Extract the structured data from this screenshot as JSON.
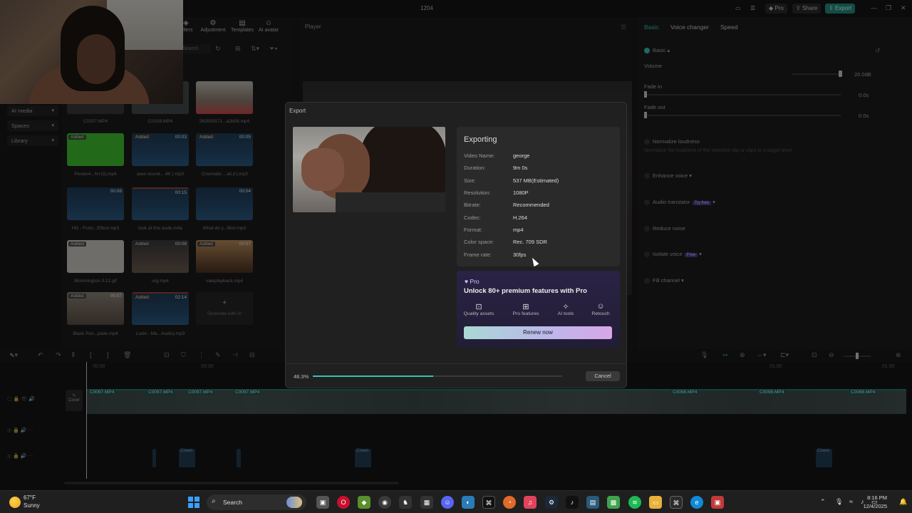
{
  "window": {
    "title": "1204",
    "pro_label": "Pro",
    "share_label": "Share",
    "export_label": "Export",
    "min": "—",
    "max": "❐",
    "close": "✕"
  },
  "toolbar_tabs": [
    {
      "label": "Filters",
      "icon": "filters-icon"
    },
    {
      "label": "Adjustment",
      "icon": "adjustment-icon"
    },
    {
      "label": "Templates",
      "icon": "templates-icon"
    },
    {
      "label": "AI avatar",
      "icon": "ai-avatar-icon"
    }
  ],
  "left_nav": [
    {
      "label": "AI media"
    },
    {
      "label": "Spaces"
    },
    {
      "label": "Library"
    }
  ],
  "media_search_placeholder": "Search",
  "media": [
    {
      "label": "C0207.MP4",
      "badge": "",
      "dur": ""
    },
    {
      "label": "C0108.MP4",
      "badge": "",
      "dur": ""
    },
    {
      "label": "263555571...a2b08.mp4",
      "badge": "",
      "dur": ""
    },
    {
      "label": "Pexels4...N+(3).mp4",
      "badge": "Added",
      "dur": ""
    },
    {
      "label": "aww sound... 4K (.mp3",
      "badge": "Added",
      "dur": "00:03"
    },
    {
      "label": "Cinematic ...all.(r).mp3",
      "badge": "Added",
      "dur": "00:05"
    },
    {
      "label": "HD - Funn...Effect.mp3",
      "badge": "",
      "dur": "00:08"
    },
    {
      "label": "look at this dude.m4a",
      "badge": "",
      "dur": "00:15"
    },
    {
      "label": "What do y...ffect.mp3",
      "badge": "",
      "dur": "00:04"
    },
    {
      "label": "Bloomington-3.12.gif",
      "badge": "Added",
      "dur": ""
    },
    {
      "label": "org.mp4",
      "badge": "Added",
      "dur": "00:08"
    },
    {
      "label": "valeplayback.mp4",
      "badge": "Added",
      "dur": "00:07"
    },
    {
      "label": "Black Pun...plate.mp4",
      "badge": "Added",
      "dur": "00:07"
    },
    {
      "label": "Lucki - Ma...Audio).mp3",
      "badge": "Added",
      "dur": "02:14"
    },
    {
      "label": "Generate with AI",
      "badge": "",
      "dur": ""
    }
  ],
  "player": {
    "label": "Player"
  },
  "right_panel": {
    "tabs": [
      "Basic",
      "Voice changer",
      "Speed"
    ],
    "basic_label": "Basic",
    "volume_label": "Volume",
    "volume_value": "20.0dB",
    "fade_in_label": "Fade in",
    "fade_in_value": "0.0s",
    "fade_out_label": "Fade out",
    "fade_out_value": "0.0s",
    "normalize_label": "Normalize loudness",
    "normalize_sub": "Normalize the loudness of the selected clip or clips to a target level",
    "enhance_label": "Enhance voice",
    "translator_label": "Audio translator",
    "translator_tag": "Try free",
    "reduce_label": "Reduce noise",
    "isolate_label": "Isolate voice",
    "isolate_tag": "Free",
    "fill_label": "Fill channel"
  },
  "timeline": {
    "ruler": [
      "00:00",
      "00:30",
      "01:00",
      "01:30",
      "02:00",
      "02:30",
      "03:00",
      "03:30",
      "04:00",
      "04:30"
    ],
    "cover_label": "Cover",
    "clip_labels": [
      "C0097.MP4",
      "C0097.MP4",
      "C0097.MP4",
      "C0097.MP4",
      "C0098.MP4",
      "C0098.MP4",
      "C0098.MP4"
    ],
    "audio_labels": [
      "Cinem",
      "Cinem",
      "Cinem"
    ]
  },
  "export": {
    "header": "Export",
    "status": "Exporting",
    "details": [
      {
        "key": "Video Name:",
        "value": "george"
      },
      {
        "key": "Duration:",
        "value": "9m 0s"
      },
      {
        "key": "Size:",
        "value": "537 MB(Estimated)"
      },
      {
        "key": "Resolution:",
        "value": "1080P"
      },
      {
        "key": "Bitrate:",
        "value": "Recommended"
      },
      {
        "key": "Codec:",
        "value": "H.264"
      },
      {
        "key": "Format:",
        "value": "mp4"
      },
      {
        "key": "Color space:",
        "value": "Rec. 709 SDR"
      },
      {
        "key": "Frame rate:",
        "value": "30fps"
      }
    ],
    "pro": {
      "title": "Pro",
      "headline": "Unlock 80+ premium features with Pro",
      "features": [
        {
          "label": "Quality assets",
          "icon": "quality-assets-icon"
        },
        {
          "label": "Pro features",
          "icon": "pro-features-icon"
        },
        {
          "label": "AI tools",
          "icon": "ai-tools-icon"
        },
        {
          "label": "Retouch",
          "icon": "retouch-icon"
        }
      ],
      "renew_label": "Renew now"
    },
    "progress_text": "48.3%",
    "progress": 0.483,
    "cancel_label": "Cancel"
  },
  "taskbar": {
    "temp": "67°F",
    "condition": "Sunny",
    "search_label": "Search",
    "time": "8:16 PM",
    "date": "12/4/2025"
  },
  "colors": {
    "accent": "#39c2b0",
    "pro": "#4c3c8f"
  }
}
